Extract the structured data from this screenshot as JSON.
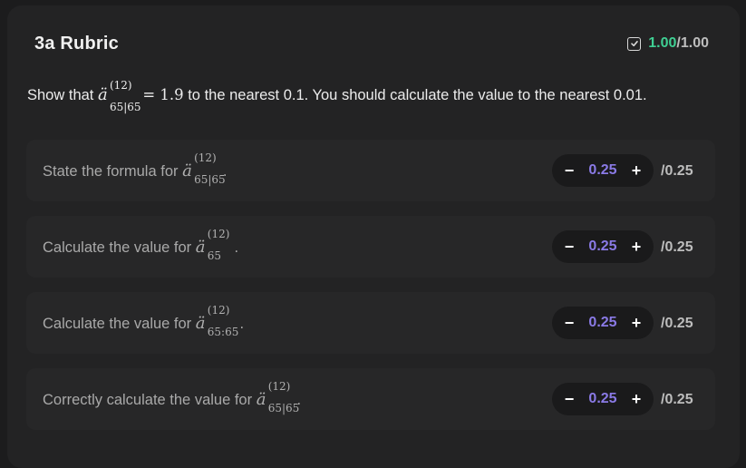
{
  "rubric": {
    "title": "3a Rubric",
    "score": {
      "got": "1.00",
      "total": "/1.00",
      "icon": "checkbox-checked-icon",
      "color": "#3fcf93"
    }
  },
  "question": {
    "prefix": "Show that",
    "symbol": {
      "base": "ä",
      "sup": "(12)",
      "sub": "65|65"
    },
    "equals": "= 1.9",
    "suffix": "to the nearest 0.1. You should calculate the value to the nearest 0.01."
  },
  "criteria": [
    {
      "label": "State the formula for",
      "symbol": {
        "base": "ä",
        "sup": "(12)",
        "sub": "65|65"
      },
      "end": ".",
      "value": "0.25",
      "max": "/0.25"
    },
    {
      "label": "Calculate the value for",
      "symbol": {
        "base": "ä",
        "sup": "(12)",
        "sub": "65"
      },
      "end": ".",
      "value": "0.25",
      "max": "/0.25"
    },
    {
      "label": "Calculate the value for",
      "symbol": {
        "base": "ä",
        "sup": "(12)",
        "sub": "65:65"
      },
      "end": ".",
      "value": "0.25",
      "max": "/0.25"
    },
    {
      "label": "Correctly calculate the value for",
      "symbol": {
        "base": "ä",
        "sup": "(12)",
        "sub": "65|65"
      },
      "end": ".",
      "value": "0.25",
      "max": "/0.25"
    }
  ],
  "stepper": {
    "minus": "−",
    "plus": "+"
  },
  "colors": {
    "accent": "#8a7ae6",
    "success": "#3fcf93",
    "background": "#1c1c1d"
  }
}
